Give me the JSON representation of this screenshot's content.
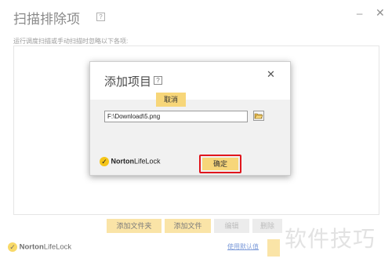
{
  "window": {
    "title": "扫描排除项",
    "help_icon": "?",
    "subtitle": "运行调度扫描或手动扫描时忽略以下各项:",
    "buttons": {
      "add_folder": "添加文件夹",
      "add_file": "添加文件",
      "edit": "编辑",
      "delete": "删除"
    },
    "default_link": "使用默认值",
    "brand": {
      "name_bold": "Norton",
      "name_rest": "LifeLock"
    }
  },
  "dialog": {
    "title": "添加项目",
    "help_icon": "?",
    "path_value": "F:\\Download\\5.png",
    "confirm_label": "确定",
    "cancel_label": "取消",
    "brand": {
      "name_bold": "Norton",
      "name_rest": "LifeLock"
    }
  },
  "watermark": "软件技巧",
  "colors": {
    "accent": "#f7d679",
    "highlight": "#e0161d",
    "link": "#3a68c6"
  },
  "icons": [
    "help-icon",
    "minimize-icon",
    "close-icon",
    "folder-open-icon",
    "norton-check-icon"
  ]
}
